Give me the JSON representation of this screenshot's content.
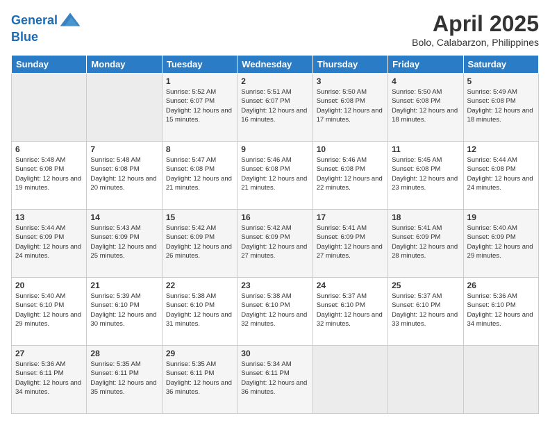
{
  "logo": {
    "line1": "General",
    "line2": "Blue"
  },
  "title": "April 2025",
  "subtitle": "Bolo, Calabarzon, Philippines",
  "days_of_week": [
    "Sunday",
    "Monday",
    "Tuesday",
    "Wednesday",
    "Thursday",
    "Friday",
    "Saturday"
  ],
  "weeks": [
    [
      {
        "day": "",
        "empty": true
      },
      {
        "day": "",
        "empty": true
      },
      {
        "day": "1",
        "sunrise": "Sunrise: 5:52 AM",
        "sunset": "Sunset: 6:07 PM",
        "daylight": "Daylight: 12 hours and 15 minutes."
      },
      {
        "day": "2",
        "sunrise": "Sunrise: 5:51 AM",
        "sunset": "Sunset: 6:07 PM",
        "daylight": "Daylight: 12 hours and 16 minutes."
      },
      {
        "day": "3",
        "sunrise": "Sunrise: 5:50 AM",
        "sunset": "Sunset: 6:08 PM",
        "daylight": "Daylight: 12 hours and 17 minutes."
      },
      {
        "day": "4",
        "sunrise": "Sunrise: 5:50 AM",
        "sunset": "Sunset: 6:08 PM",
        "daylight": "Daylight: 12 hours and 18 minutes."
      },
      {
        "day": "5",
        "sunrise": "Sunrise: 5:49 AM",
        "sunset": "Sunset: 6:08 PM",
        "daylight": "Daylight: 12 hours and 18 minutes."
      }
    ],
    [
      {
        "day": "6",
        "sunrise": "Sunrise: 5:48 AM",
        "sunset": "Sunset: 6:08 PM",
        "daylight": "Daylight: 12 hours and 19 minutes."
      },
      {
        "day": "7",
        "sunrise": "Sunrise: 5:48 AM",
        "sunset": "Sunset: 6:08 PM",
        "daylight": "Daylight: 12 hours and 20 minutes."
      },
      {
        "day": "8",
        "sunrise": "Sunrise: 5:47 AM",
        "sunset": "Sunset: 6:08 PM",
        "daylight": "Daylight: 12 hours and 21 minutes."
      },
      {
        "day": "9",
        "sunrise": "Sunrise: 5:46 AM",
        "sunset": "Sunset: 6:08 PM",
        "daylight": "Daylight: 12 hours and 21 minutes."
      },
      {
        "day": "10",
        "sunrise": "Sunrise: 5:46 AM",
        "sunset": "Sunset: 6:08 PM",
        "daylight": "Daylight: 12 hours and 22 minutes."
      },
      {
        "day": "11",
        "sunrise": "Sunrise: 5:45 AM",
        "sunset": "Sunset: 6:08 PM",
        "daylight": "Daylight: 12 hours and 23 minutes."
      },
      {
        "day": "12",
        "sunrise": "Sunrise: 5:44 AM",
        "sunset": "Sunset: 6:08 PM",
        "daylight": "Daylight: 12 hours and 24 minutes."
      }
    ],
    [
      {
        "day": "13",
        "sunrise": "Sunrise: 5:44 AM",
        "sunset": "Sunset: 6:09 PM",
        "daylight": "Daylight: 12 hours and 24 minutes."
      },
      {
        "day": "14",
        "sunrise": "Sunrise: 5:43 AM",
        "sunset": "Sunset: 6:09 PM",
        "daylight": "Daylight: 12 hours and 25 minutes."
      },
      {
        "day": "15",
        "sunrise": "Sunrise: 5:42 AM",
        "sunset": "Sunset: 6:09 PM",
        "daylight": "Daylight: 12 hours and 26 minutes."
      },
      {
        "day": "16",
        "sunrise": "Sunrise: 5:42 AM",
        "sunset": "Sunset: 6:09 PM",
        "daylight": "Daylight: 12 hours and 27 minutes."
      },
      {
        "day": "17",
        "sunrise": "Sunrise: 5:41 AM",
        "sunset": "Sunset: 6:09 PM",
        "daylight": "Daylight: 12 hours and 27 minutes."
      },
      {
        "day": "18",
        "sunrise": "Sunrise: 5:41 AM",
        "sunset": "Sunset: 6:09 PM",
        "daylight": "Daylight: 12 hours and 28 minutes."
      },
      {
        "day": "19",
        "sunrise": "Sunrise: 5:40 AM",
        "sunset": "Sunset: 6:09 PM",
        "daylight": "Daylight: 12 hours and 29 minutes."
      }
    ],
    [
      {
        "day": "20",
        "sunrise": "Sunrise: 5:40 AM",
        "sunset": "Sunset: 6:10 PM",
        "daylight": "Daylight: 12 hours and 29 minutes."
      },
      {
        "day": "21",
        "sunrise": "Sunrise: 5:39 AM",
        "sunset": "Sunset: 6:10 PM",
        "daylight": "Daylight: 12 hours and 30 minutes."
      },
      {
        "day": "22",
        "sunrise": "Sunrise: 5:38 AM",
        "sunset": "Sunset: 6:10 PM",
        "daylight": "Daylight: 12 hours and 31 minutes."
      },
      {
        "day": "23",
        "sunrise": "Sunrise: 5:38 AM",
        "sunset": "Sunset: 6:10 PM",
        "daylight": "Daylight: 12 hours and 32 minutes."
      },
      {
        "day": "24",
        "sunrise": "Sunrise: 5:37 AM",
        "sunset": "Sunset: 6:10 PM",
        "daylight": "Daylight: 12 hours and 32 minutes."
      },
      {
        "day": "25",
        "sunrise": "Sunrise: 5:37 AM",
        "sunset": "Sunset: 6:10 PM",
        "daylight": "Daylight: 12 hours and 33 minutes."
      },
      {
        "day": "26",
        "sunrise": "Sunrise: 5:36 AM",
        "sunset": "Sunset: 6:10 PM",
        "daylight": "Daylight: 12 hours and 34 minutes."
      }
    ],
    [
      {
        "day": "27",
        "sunrise": "Sunrise: 5:36 AM",
        "sunset": "Sunset: 6:11 PM",
        "daylight": "Daylight: 12 hours and 34 minutes."
      },
      {
        "day": "28",
        "sunrise": "Sunrise: 5:35 AM",
        "sunset": "Sunset: 6:11 PM",
        "daylight": "Daylight: 12 hours and 35 minutes."
      },
      {
        "day": "29",
        "sunrise": "Sunrise: 5:35 AM",
        "sunset": "Sunset: 6:11 PM",
        "daylight": "Daylight: 12 hours and 36 minutes."
      },
      {
        "day": "30",
        "sunrise": "Sunrise: 5:34 AM",
        "sunset": "Sunset: 6:11 PM",
        "daylight": "Daylight: 12 hours and 36 minutes."
      },
      {
        "day": "",
        "empty": true
      },
      {
        "day": "",
        "empty": true
      },
      {
        "day": "",
        "empty": true
      }
    ]
  ]
}
